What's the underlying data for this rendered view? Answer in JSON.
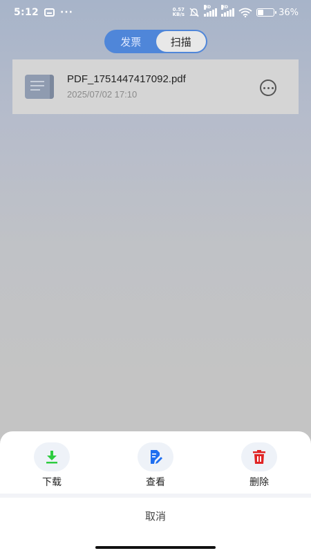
{
  "status_bar": {
    "time": "5:12",
    "overflow": "···",
    "net_speed_value": "0.57",
    "net_speed_unit": "KB/s",
    "hd1": "HD",
    "hd2": "HD",
    "battery_percent": "36",
    "battery_symbol": "%"
  },
  "toggle": {
    "options": [
      "发票",
      "扫描"
    ],
    "active_index": 1
  },
  "file": {
    "name": "PDF_1751447417092.pdf",
    "date": "2025/07/02 17:10",
    "icon": "document-icon"
  },
  "sheet": {
    "actions": [
      {
        "label": "下载",
        "icon": "download-icon",
        "color": "#2ecc40"
      },
      {
        "label": "查看",
        "icon": "edit-document-icon",
        "color": "#1e6ef0"
      },
      {
        "label": "删除",
        "icon": "trash-icon",
        "color": "#e02424"
      }
    ],
    "cancel_label": "取消"
  }
}
